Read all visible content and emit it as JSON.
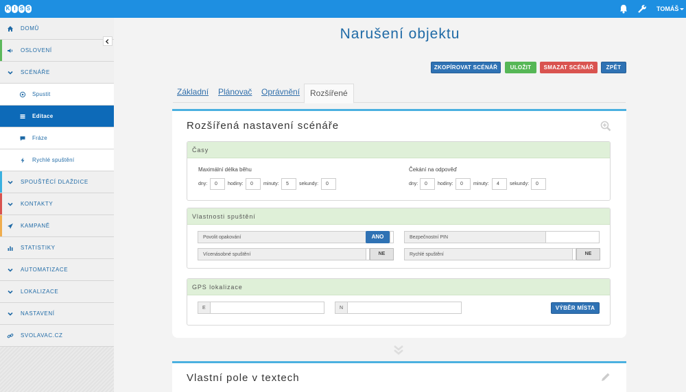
{
  "app": {
    "logo_letters": [
      "K",
      "I",
      "S",
      "S"
    ],
    "user": "TOMÁŠ"
  },
  "sidebar": {
    "items": [
      {
        "label": "DOMŮ",
        "icon": "home-icon"
      },
      {
        "label": "OSLOVENÍ",
        "icon": "volume-icon"
      },
      {
        "label": "SCÉNÁŘE",
        "icon": "chevron-down-icon"
      },
      {
        "label": "Spustit",
        "icon": "play-circle-icon"
      },
      {
        "label": "Editace",
        "icon": "list-icon"
      },
      {
        "label": "Fráze",
        "icon": "comment-icon"
      },
      {
        "label": "Rychlé spuštění",
        "icon": "bolt-icon"
      },
      {
        "label": "SPOUŠTĚCÍ DLAŽDICE",
        "icon": "chevron-down-icon"
      },
      {
        "label": "KONTAKTY",
        "icon": "chevron-down-icon"
      },
      {
        "label": "KAMPANĚ",
        "icon": "send-icon"
      },
      {
        "label": "STATISTIKY",
        "icon": "bar-chart-icon"
      },
      {
        "label": "AUTOMATIZACE",
        "icon": "chevron-down-icon"
      },
      {
        "label": "LOKALIZACE",
        "icon": "chevron-down-icon"
      },
      {
        "label": "NASTAVENÍ",
        "icon": "chevron-down-icon"
      },
      {
        "label": "SVOLAVAC.CZ",
        "icon": "link-icon"
      }
    ],
    "accent_colors": {
      "osloveni": "#5cb85c",
      "spoustecí": "#3ab0e0",
      "kontakty": "#d9534f",
      "kampane": "#f0ad4e"
    }
  },
  "page": {
    "title": "Narušení objektu",
    "actions": {
      "copy": "ZKOPÍROVAT SCÉNÁŘ",
      "save": "ULOŽIT",
      "delete": "SMAZAT SCÉNÁŘ",
      "back": "ZPĚT"
    },
    "tabs": [
      "Základní",
      "Plánovač",
      "Oprávnění",
      "Rozšířené"
    ]
  },
  "advanced": {
    "title": "Rozšířená nastavení scénáře",
    "times": {
      "heading": "Časy",
      "max_run": {
        "title": "Maximální délka běhu",
        "dny": "0",
        "hodiny": "0",
        "minuty": "5",
        "sekundy": "0"
      },
      "wait": {
        "title": "Čekání na odpověď",
        "dny": "0",
        "hodiny": "0",
        "minuty": "4",
        "sekundy": "0"
      },
      "labels": {
        "dny": "dny:",
        "hodiny": "hodiny:",
        "minuty": "minuty:",
        "sekundy": "sekundy:"
      }
    },
    "launch": {
      "heading": "Vlastnosti spuštění",
      "allow_repeat": {
        "label": "Povolit opakování",
        "value": "ANO"
      },
      "multiple": {
        "label": "Vícenásobné spuštění",
        "value": "NE"
      },
      "pin": {
        "label": "Bezpečnostní PIN",
        "value": ""
      },
      "quick": {
        "label": "Rychlé spuštění",
        "value": "NE"
      }
    },
    "gps": {
      "heading": "GPS lokalizace",
      "e_label": "E",
      "n_label": "N",
      "e_value": "",
      "n_value": "",
      "pick_button": "VÝBĚR MÍSTA"
    }
  },
  "custom_fields": {
    "title": "Vlastní pole v textech"
  }
}
